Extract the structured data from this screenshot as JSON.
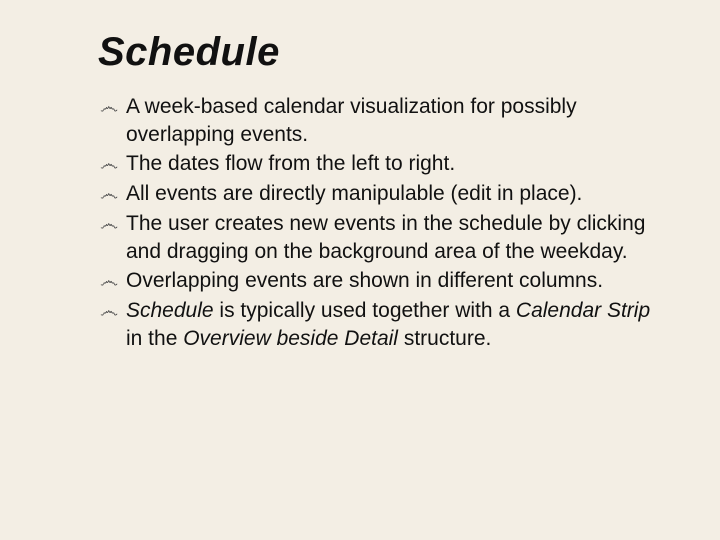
{
  "title": "Schedule",
  "bullet_glyph": "෴",
  "bullets": [
    {
      "runs": [
        {
          "text": "A week-based calendar visualization for possibly overlapping events."
        }
      ]
    },
    {
      "runs": [
        {
          "text": "The dates flow from the left to right."
        }
      ]
    },
    {
      "runs": [
        {
          "text": "All events are directly manipulable (edit in place)."
        }
      ]
    },
    {
      "runs": [
        {
          "text": "The user creates new events in the schedule by clicking and dragging on the background area of the weekday."
        }
      ]
    },
    {
      "runs": [
        {
          "text": "Overlapping events are shown in different columns."
        }
      ]
    },
    {
      "runs": [
        {
          "text": "Schedule",
          "italic": true
        },
        {
          "text": " is typically used together with a "
        },
        {
          "text": "Calendar Strip",
          "italic": true
        },
        {
          "text": " in the "
        },
        {
          "text": "Overview beside Detail",
          "italic": true
        },
        {
          "text": " structure."
        }
      ]
    }
  ]
}
